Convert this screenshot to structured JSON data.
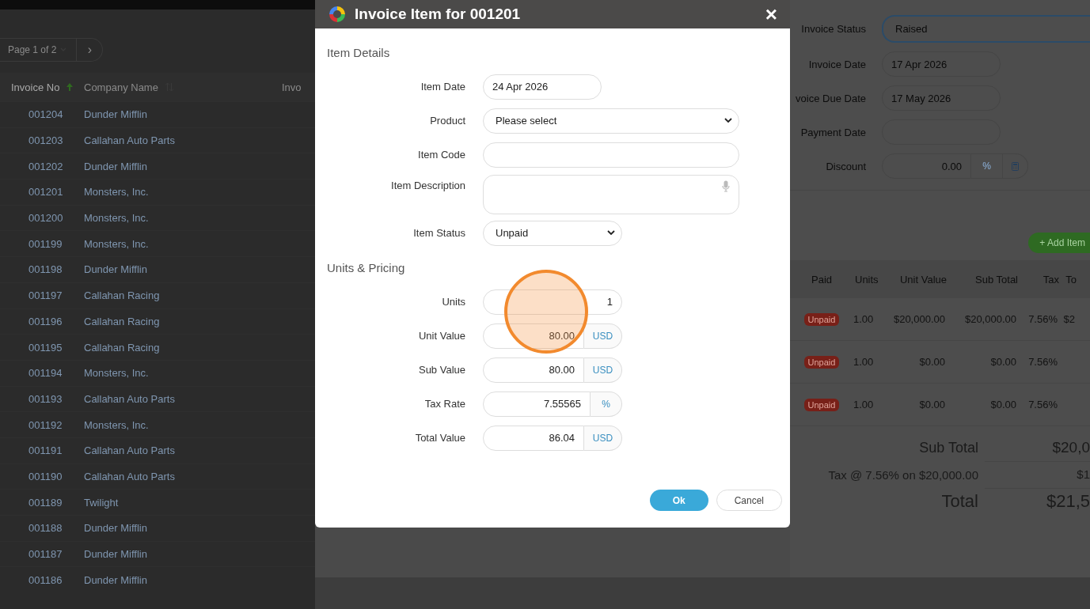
{
  "invoice_list": {
    "pagination": {
      "page_label": "Page 1 of 2",
      "next": "›"
    },
    "columns": [
      {
        "label": "Invoice No",
        "sorted": true
      },
      {
        "label": "Company Name",
        "sorted": false
      },
      {
        "label": "Invo"
      }
    ],
    "rows": [
      {
        "invoice_no": "001204",
        "company": "Dunder Mifflin"
      },
      {
        "invoice_no": "001203",
        "company": "Callahan Auto Parts"
      },
      {
        "invoice_no": "001202",
        "company": "Dunder Mifflin"
      },
      {
        "invoice_no": "001201",
        "company": "Monsters, Inc."
      },
      {
        "invoice_no": "001200",
        "company": "Monsters, Inc."
      },
      {
        "invoice_no": "001199",
        "company": "Monsters, Inc."
      },
      {
        "invoice_no": "001198",
        "company": "Dunder Mifflin"
      },
      {
        "invoice_no": "001197",
        "company": "Callahan Racing"
      },
      {
        "invoice_no": "001196",
        "company": "Callahan Racing"
      },
      {
        "invoice_no": "001195",
        "company": "Callahan Racing"
      },
      {
        "invoice_no": "001194",
        "company": "Monsters, Inc."
      },
      {
        "invoice_no": "001193",
        "company": "Callahan Auto Parts"
      },
      {
        "invoice_no": "001192",
        "company": "Monsters, Inc."
      },
      {
        "invoice_no": "001191",
        "company": "Callahan Auto Parts"
      },
      {
        "invoice_no": "001190",
        "company": "Callahan Auto Parts"
      },
      {
        "invoice_no": "001189",
        "company": "Twilight"
      },
      {
        "invoice_no": "001188",
        "company": "Dunder Mifflin"
      },
      {
        "invoice_no": "001187",
        "company": "Dunder Mifflin"
      },
      {
        "invoice_no": "001186",
        "company": "Dunder Mifflin"
      }
    ]
  },
  "dialog": {
    "title": "Invoice Item for 001201",
    "close": "×",
    "sections": [
      {
        "heading": "Item Details",
        "fields": [
          {
            "label": "Item Date",
            "kind": "date",
            "value": "24 Apr 2026"
          },
          {
            "label": "Product",
            "kind": "select",
            "placeholder": "Please select"
          },
          {
            "label": "Item Code",
            "kind": "text"
          },
          {
            "label": "Item Description",
            "kind": "textarea"
          },
          {
            "label": "Item Status",
            "kind": "status",
            "value": "Unpaid"
          }
        ]
      },
      {
        "heading": "Units & Pricing",
        "fields": [
          {
            "label": "Units",
            "kind": "number",
            "value": "1"
          },
          {
            "label": "Unit Value",
            "kind": "number",
            "value": "80.00",
            "unit": "USD"
          },
          {
            "label": "Sub Value",
            "kind": "number",
            "value": "80.00",
            "unit": "USD"
          },
          {
            "label": "Tax Rate",
            "kind": "number",
            "value": "7.55565",
            "unit": "%"
          },
          {
            "label": "Total Value",
            "kind": "number",
            "value": "86.04",
            "unit": "USD"
          }
        ]
      }
    ],
    "buttons": [
      {
        "label": "Ok",
        "kind": "primary"
      },
      {
        "label": "Cancel",
        "kind": "secondary"
      }
    ]
  },
  "invoice_panel": {
    "fields": [
      {
        "label": "Invoice Status",
        "kind": "select",
        "value": "Raised",
        "focused": true
      },
      {
        "label": "Invoice Date",
        "kind": "date",
        "value": "17 Apr 2026",
        "focused": false
      },
      {
        "label": "voice Due Date",
        "kind": "date",
        "value": "17 May 2026",
        "focused": false
      },
      {
        "label": "Payment Date",
        "kind": "date",
        "focused": false
      }
    ],
    "discount": {
      "label": "Discount",
      "value": "0.00",
      "unit": "%"
    },
    "add_item": "+ Add Item",
    "items_table": {
      "columns": [
        "Paid",
        "Units",
        "Unit Value",
        "Sub Total",
        "Tax",
        "To"
      ],
      "rows": [
        {
          "status": "Unpaid",
          "units": "1.00",
          "unit_value": "$20,000.00",
          "sub_total": "$20,000.00",
          "tax": "7.56%",
          "total": "$2"
        },
        {
          "status": "Unpaid",
          "units": "1.00",
          "unit_value": "$0.00",
          "sub_total": "$0.00",
          "tax": "7.56%"
        },
        {
          "status": "Unpaid",
          "units": "1.00",
          "unit_value": "$0.00",
          "sub_total": "$0.00",
          "tax": "7.56%"
        }
      ]
    },
    "summary": [
      {
        "label": "Sub Total",
        "value": "$20,0",
        "kind": "subtotal"
      },
      {
        "label": "Tax @ 7.56% on $20,000.00",
        "value": "$1",
        "kind": "tax"
      },
      {
        "label": "Total",
        "value": "$21,5",
        "kind": "total"
      }
    ]
  }
}
